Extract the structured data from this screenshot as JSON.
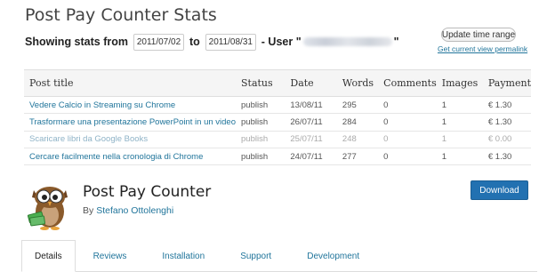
{
  "banner": {
    "title": "Post Pay Counter Stats",
    "showing_label": "Showing stats from",
    "start_date": "2011/07/02",
    "to_label": "to",
    "end_date": "2011/08/31",
    "user_label": "- User \"",
    "user_close": "\"",
    "update_button": "Update time range",
    "permalink": "Get current view permalink",
    "table": {
      "headers": [
        "Post title",
        "Status",
        "Date",
        "Words",
        "Comments",
        "Images",
        "Payment"
      ],
      "rows": [
        {
          "title": "Vedere Calcio in Streaming su Chrome",
          "status": "publish",
          "date": "13/08/11",
          "words": "295",
          "comments": "0",
          "images": "1",
          "payment": "€ 1.30"
        },
        {
          "title": "Trasformare una presentazione PowerPoint in un video",
          "status": "publish",
          "date": "26/07/11",
          "words": "284",
          "comments": "0",
          "images": "1",
          "payment": "€ 1.30"
        },
        {
          "title": "Scaricare libri da Google Books",
          "status": "publish",
          "date": "25/07/11",
          "words": "248",
          "comments": "0",
          "images": "1",
          "payment": "€ 0.00"
        },
        {
          "title": "Cercare facilmente nella cronologia di Chrome",
          "status": "publish",
          "date": "24/07/11",
          "words": "277",
          "comments": "0",
          "images": "1",
          "payment": "€ 1.30"
        }
      ]
    }
  },
  "plugin": {
    "name": "Post Pay Counter",
    "by_label": "By",
    "author": "Stefano Ottolenghi",
    "download_button": "Download"
  },
  "tabs": [
    {
      "label": "Details",
      "active": true
    },
    {
      "label": "Reviews",
      "active": false
    },
    {
      "label": "Installation",
      "active": false
    },
    {
      "label": "Support",
      "active": false
    },
    {
      "label": "Development",
      "active": false
    }
  ],
  "colors": {
    "link": "#21759b",
    "download_bg": "#2271b1"
  }
}
